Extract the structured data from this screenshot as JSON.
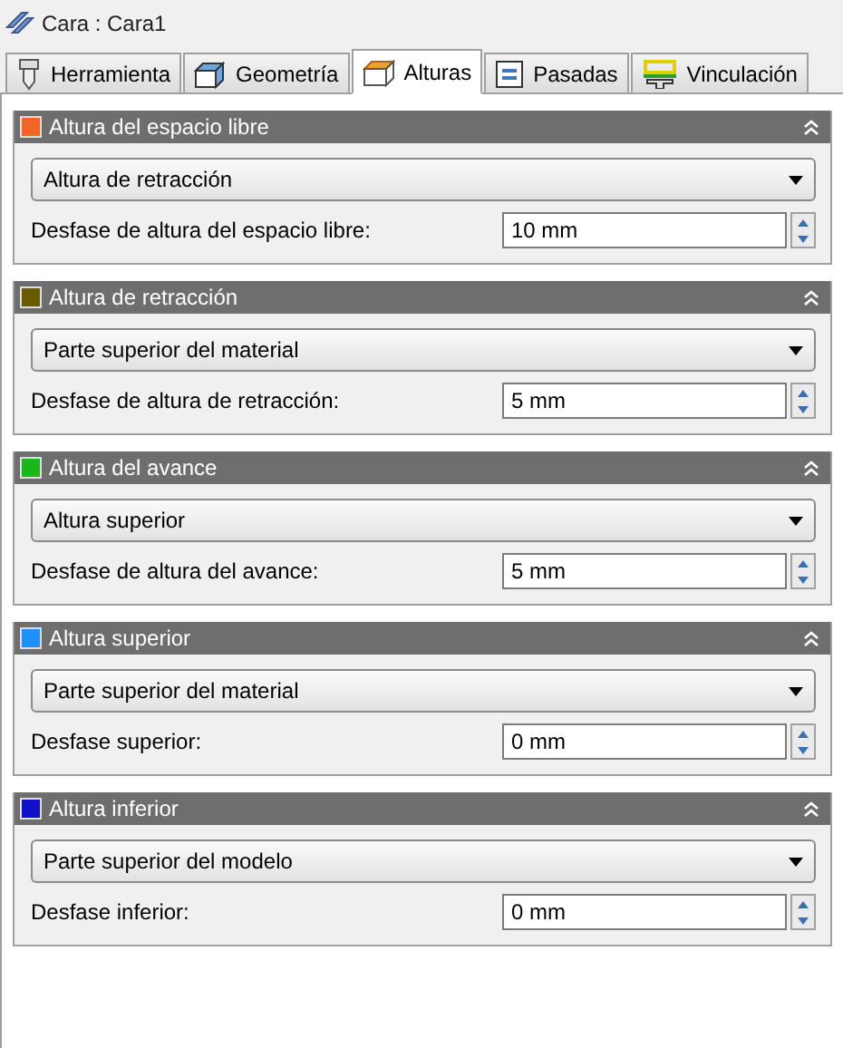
{
  "window": {
    "title": "Cara : Cara1"
  },
  "tabs": [
    {
      "label": "Herramienta",
      "selected": false
    },
    {
      "label": "Geometría",
      "selected": false
    },
    {
      "label": "Alturas",
      "selected": true
    },
    {
      "label": "Pasadas",
      "selected": false
    },
    {
      "label": "Vinculación",
      "selected": false
    }
  ],
  "sections": [
    {
      "title": "Altura del espacio libre",
      "color": "#f26522",
      "expanded": true,
      "select": "Altura de retracción",
      "offset_label": "Desfase de altura del espacio libre:",
      "offset": "10 mm"
    },
    {
      "title": "Altura de retracción",
      "color": "#6b5b00",
      "expanded": true,
      "select": "Parte superior del material",
      "offset_label": "Desfase de altura de retracción:",
      "offset": "5 mm"
    },
    {
      "title": "Altura del avance",
      "color": "#18b818",
      "expanded": true,
      "select": "Altura superior",
      "offset_label": "Desfase de altura del avance:",
      "offset": "5 mm"
    },
    {
      "title": "Altura superior",
      "color": "#1e90ff",
      "expanded": true,
      "select": "Parte superior del material",
      "offset_label": "Desfase superior:",
      "offset": "0 mm"
    },
    {
      "title": "Altura inferior",
      "color": "#1010c8",
      "expanded": true,
      "select": "Parte superior del modelo",
      "offset_label": "Desfase inferior:",
      "offset": "0 mm"
    }
  ]
}
